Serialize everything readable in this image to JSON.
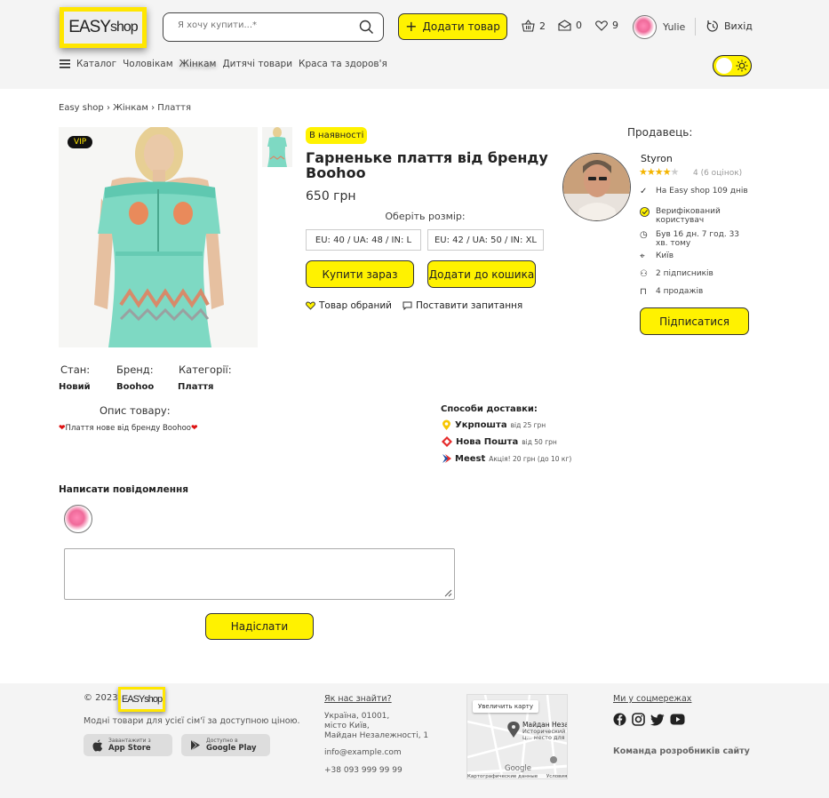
{
  "header": {
    "logo": {
      "main": "EASY",
      "sub": "shop"
    },
    "search_placeholder": "Я хочу купити...*",
    "add_product_label": "Додати товар",
    "cart_count": "2",
    "messages_count": "0",
    "favorites_count": "9",
    "username": "Yulie",
    "logout_label": "Вихід",
    "nav": [
      "Каталог",
      "Чоловікам",
      "Жінкам",
      "Дитячі товари",
      "Краса та здоров'я"
    ]
  },
  "breadcrumb": "Easy shop › Жінкам › Плаття",
  "product": {
    "vip_badge": "VIP",
    "stock": "В наявності",
    "title": "Гарненьке плаття від бренду Boohoo",
    "price": "650 грн",
    "size_label": "Оберіть розмір:",
    "sizes": [
      "EU: 40 / UA: 48 / IN: L",
      "EU: 42 / UA: 50 / IN: XL"
    ],
    "buy_now": "Купити зараз",
    "add_to_cart": "Додати до кошика",
    "favorite_label": "Товар обраний",
    "ask_label": "Поставити запитання",
    "attrs": [
      {
        "label": "Стан:",
        "value": "Новий"
      },
      {
        "label": "Бренд:",
        "value": "Boohoo"
      },
      {
        "label": "Категорії:",
        "value": "Плаття"
      }
    ],
    "desc_heading": "Опис товару:",
    "desc": "Плаття нове від бренду Boohoo"
  },
  "seller": {
    "heading": "Продавець:",
    "name": "Styron",
    "rating_stars": 4,
    "rating_text": "4 (6 оцінок)",
    "info": [
      "На Easy shop 109 днів",
      "Верифікований користувач",
      "Був 16 дн. 7 год. 33 хв. тому",
      "Київ",
      "2 підписників",
      "4 продажів"
    ],
    "subscribe_label": "Підписатися"
  },
  "delivery": {
    "heading": "Способи доставки:",
    "items": [
      {
        "name": "Укрпошта",
        "note": "від 25 грн",
        "color": "#f7c600"
      },
      {
        "name": "Нова Пошта",
        "note": "від 50 грн",
        "color": "#e52b2b"
      },
      {
        "name": "Meest",
        "note": "Акція! 20 грн (до 10 кг)",
        "color": "#1f4fa3"
      }
    ]
  },
  "message": {
    "heading": "Написати повідомлення",
    "send_label": "Надіслати"
  },
  "footer": {
    "copyright": "© 2023",
    "logo_text": "EASYshop",
    "tagline": "Модні товари для усієї сім'ї за доступною ціною.",
    "app_store_small": "Завантажити з",
    "app_store": "App Store",
    "google_play_small": "Доступно в",
    "google_play": "Google Play",
    "find_us": "Як нас знайти?",
    "address": [
      "Україна, 01001,",
      "місто Київ,",
      "Майдан Незалежності, 1"
    ],
    "email": "info@example.com",
    "phone": "+38 093 999 99 99",
    "map_button": "Увеличить карту",
    "map_title": "Майдан Незал...",
    "map_sub": "Исторический ц... место для митин...",
    "map_footer": "Картографические данные",
    "map_footer2": "Условия",
    "map_google": "Google",
    "social": "Ми у соцмережах",
    "team": "Команда розробників сайту"
  },
  "colors": {
    "accent": "#fff200",
    "logo_frame": "#ffe600"
  }
}
